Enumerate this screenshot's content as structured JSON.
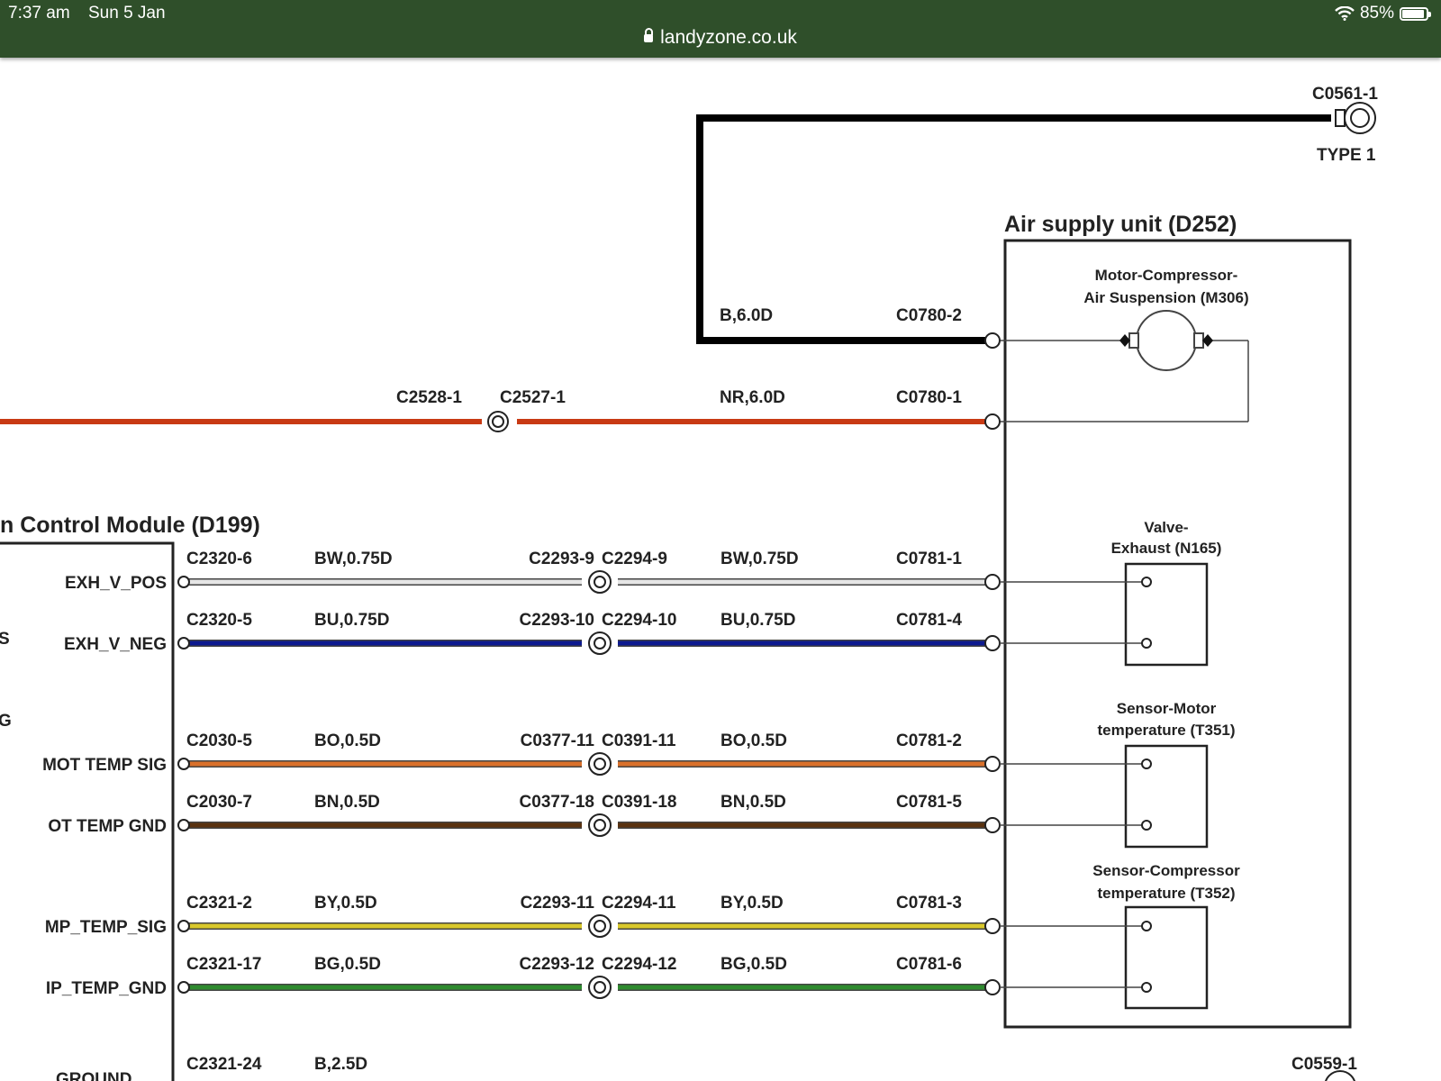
{
  "status_bar": {
    "time": "7:37 am",
    "date": "Sun 5 Jan",
    "url": "landyzone.co.uk",
    "battery": "85%"
  },
  "colors": {
    "status_bar_bg": "#2f4f2a",
    "wire_b": "#000000",
    "wire_nr": "#c83a14",
    "wire_bw": "#e6e6e6",
    "wire_bu": "#0d1a8f",
    "wire_bo": "#d9702a",
    "wire_bn": "#5a3210",
    "wire_by": "#d9c82a",
    "wire_bg": "#2e8b2e"
  },
  "diagram": {
    "top_connector": {
      "label": "C0561-1",
      "type": "TYPE 1"
    },
    "bottom_connector": {
      "label": "C0559-1"
    },
    "air_supply_unit": {
      "title": "Air supply unit (D252)",
      "motor_line1": "Motor-Compressor-",
      "motor_line2": "Air Suspension (M306)",
      "valve_line1": "Valve-",
      "valve_line2": "Exhaust (N165)",
      "sensor_motor_line1": "Sensor-Motor",
      "sensor_motor_line2": "temperature (T351)",
      "sensor_comp_line1": "Sensor-Compressor",
      "sensor_comp_line2": "temperature (T352)"
    },
    "control_module": {
      "title": "n Control Module (D199)",
      "partial_g": "G",
      "partial_s": "S"
    },
    "wires": {
      "b": {
        "spec": "B,6.0D",
        "end": "C0780-2"
      },
      "nr": {
        "conn_a": "C2528-1",
        "conn_b": "C2527-1",
        "spec": "NR,6.0D",
        "end": "C0780-1"
      },
      "rows": [
        {
          "pin": "EXH_V_POS",
          "start": "C2320-6",
          "spec1": "BW,0.75D",
          "mid_a": "C2293-9",
          "mid_b": "C2294-9",
          "spec2": "BW,0.75D",
          "end": "C0781-1"
        },
        {
          "pin": "EXH_V_NEG",
          "start": "C2320-5",
          "spec1": "BU,0.75D",
          "mid_a": "C2293-10",
          "mid_b": "C2294-10",
          "spec2": "BU,0.75D",
          "end": "C0781-4"
        },
        {
          "pin": "MOT TEMP SIG",
          "start": "C2030-5",
          "spec1": "BO,0.5D",
          "mid_a": "C0377-11",
          "mid_b": "C0391-11",
          "spec2": "BO,0.5D",
          "end": "C0781-2"
        },
        {
          "pin": "OT TEMP GND",
          "start": "C2030-7",
          "spec1": "BN,0.5D",
          "mid_a": "C0377-18",
          "mid_b": "C0391-18",
          "spec2": "BN,0.5D",
          "end": "C0781-5"
        },
        {
          "pin": "MP_TEMP_SIG",
          "start": "C2321-2",
          "spec1": "BY,0.5D",
          "mid_a": "C2293-11",
          "mid_b": "C2294-11",
          "spec2": "BY,0.5D",
          "end": "C0781-3"
        },
        {
          "pin": "IP_TEMP_GND",
          "start": "C2321-17",
          "spec1": "BG,0.5D",
          "mid_a": "C2293-12",
          "mid_b": "C2294-12",
          "spec2": "BG,0.5D",
          "end": "C0781-6"
        }
      ],
      "ground": {
        "pin": "GROUND",
        "start": "C2321-24",
        "spec": "B,2.5D"
      }
    }
  }
}
